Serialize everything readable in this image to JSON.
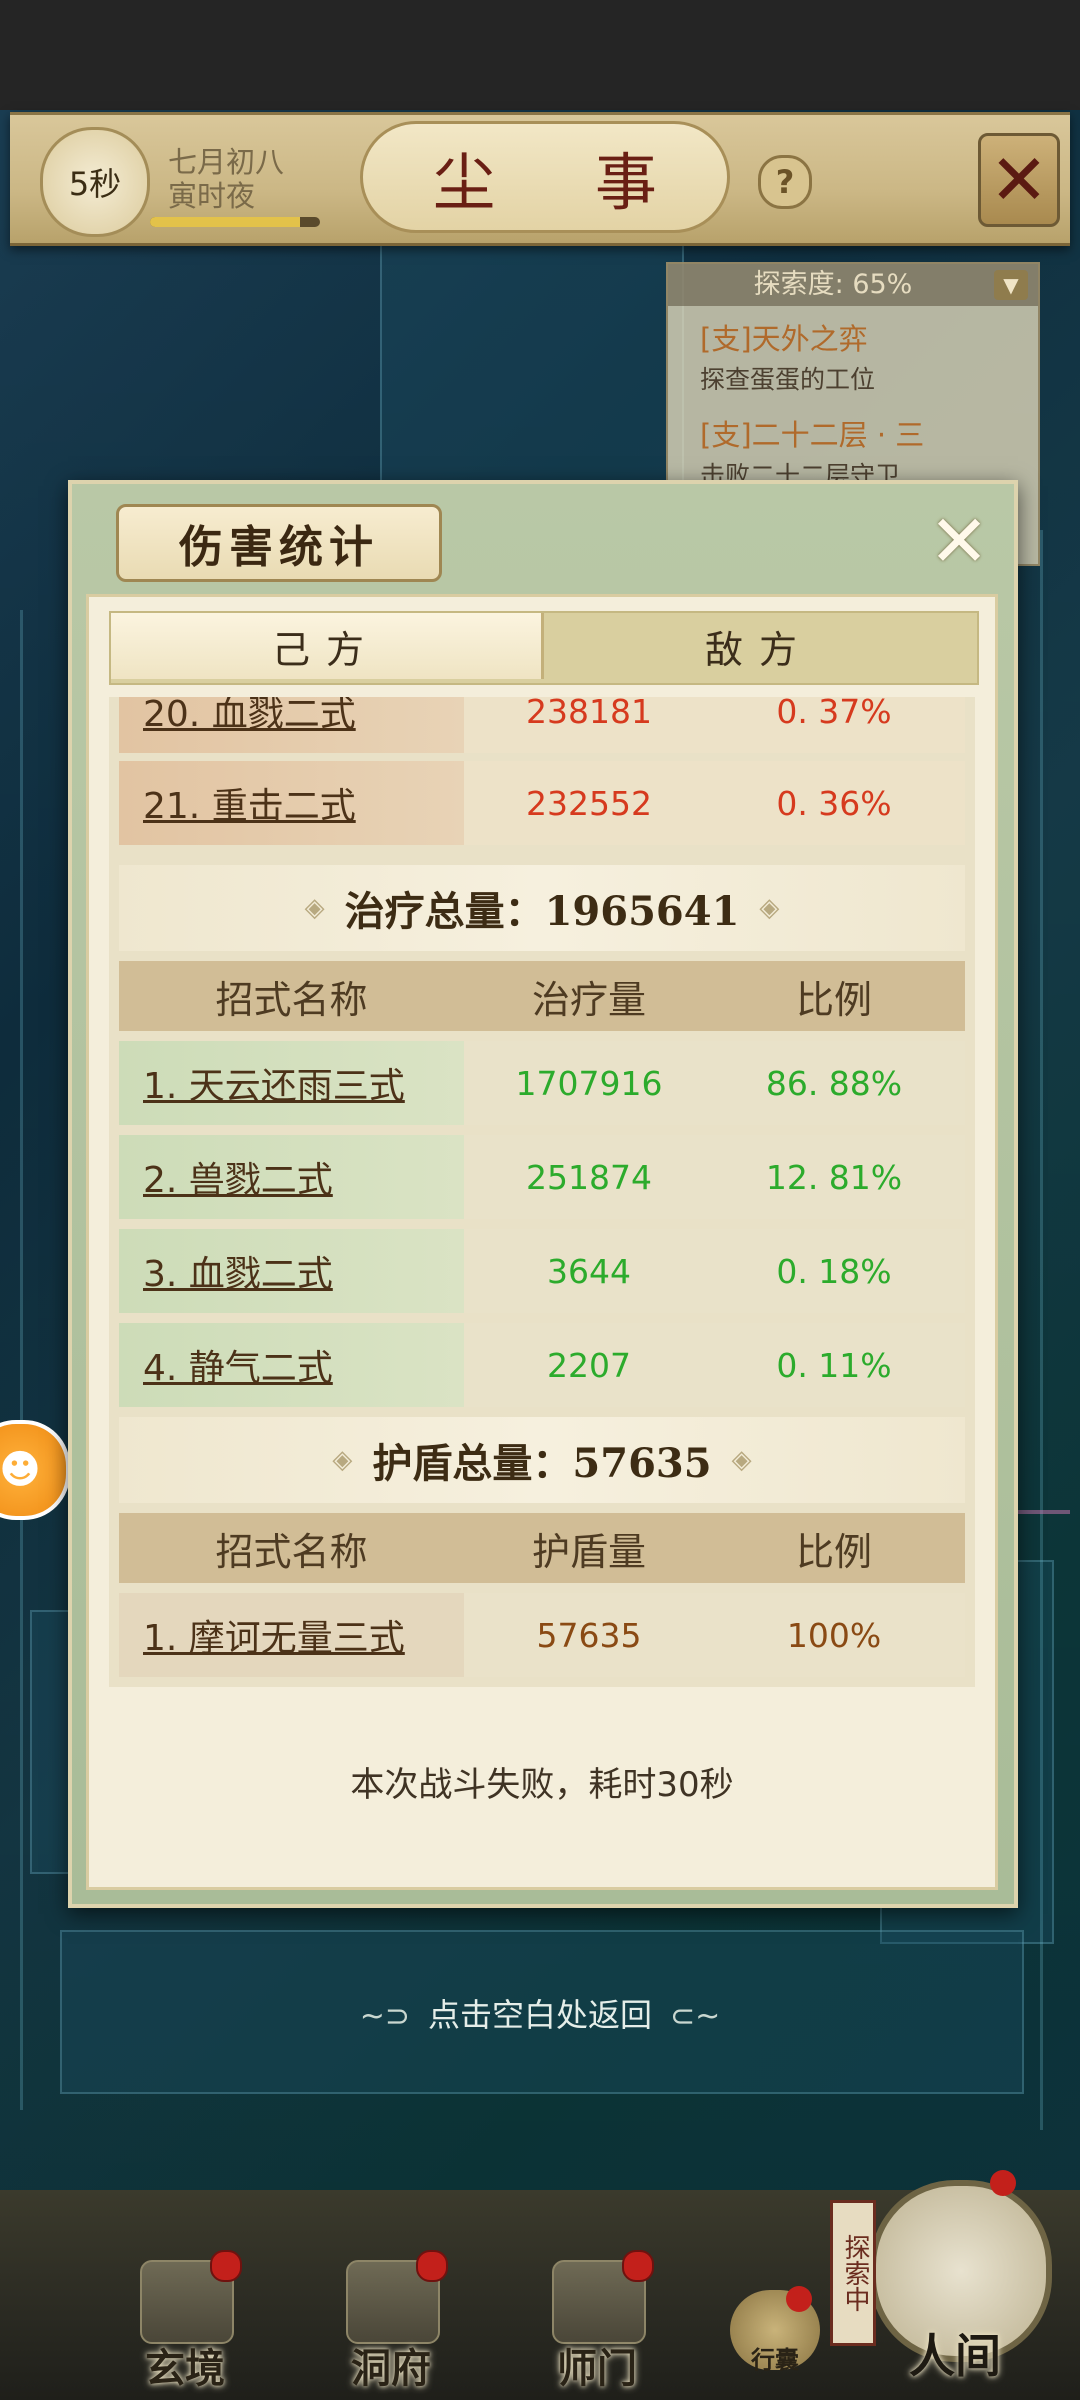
{
  "header": {
    "timer": "5秒",
    "date_line1": "七月初八",
    "date_line2": "寅时夜",
    "title": "尘 事",
    "help": "?",
    "close": "✕"
  },
  "quest_panel": {
    "progress_label": "探索度: 65%",
    "quests": [
      {
        "title": "[支]天外之弈",
        "desc": "探查蛋蛋的工位"
      },
      {
        "title": "[支]二十二层 · 三",
        "desc": "击败二十二层守卫"
      }
    ]
  },
  "dialog": {
    "title": "伤害统计",
    "close": "✕",
    "tabs": [
      {
        "label": "己方",
        "active": true
      },
      {
        "label": "敌方",
        "active": false
      }
    ],
    "damage_rows": [
      {
        "name": "20. 血戮二式",
        "value": "238181",
        "percent": "0. 37%"
      },
      {
        "name": "21. 重击二式",
        "value": "232552",
        "percent": "0. 36%"
      }
    ],
    "heal_section": {
      "title": "治疗总量：1965641",
      "col_name": "招式名称",
      "col_value": "治疗量",
      "col_percent": "比例",
      "rows": [
        {
          "name": "1. 天云还雨三式",
          "value": "1707916",
          "percent": "86. 88%"
        },
        {
          "name": "2. 兽戮二式",
          "value": "251874",
          "percent": "12. 81%"
        },
        {
          "name": "3. 血戮二式",
          "value": "3644",
          "percent": "0. 18%"
        },
        {
          "name": "4. 静气二式",
          "value": "2207",
          "percent": "0. 11%"
        }
      ]
    },
    "shield_section": {
      "title": "护盾总量：57635",
      "col_name": "招式名称",
      "col_value": "护盾量",
      "col_percent": "比例",
      "rows": [
        {
          "name": "1. 摩诃无量三式",
          "value": "57635",
          "percent": "100%"
        }
      ]
    },
    "result_text": "本次战斗失败，耗时30秒"
  },
  "return_hint": "点击空白处返回",
  "bottom_nav": {
    "items": [
      {
        "label": "玄境"
      },
      {
        "label": "洞府"
      },
      {
        "label": "师门"
      }
    ],
    "bag_label": "行囊",
    "explore_tag": "探索中",
    "world_label": "人间"
  },
  "colors": {
    "damage_text": "#d63a1e",
    "heal_text": "#2cab2c",
    "shield_text": "#8a4a14",
    "title_red": "#6a1f14"
  }
}
